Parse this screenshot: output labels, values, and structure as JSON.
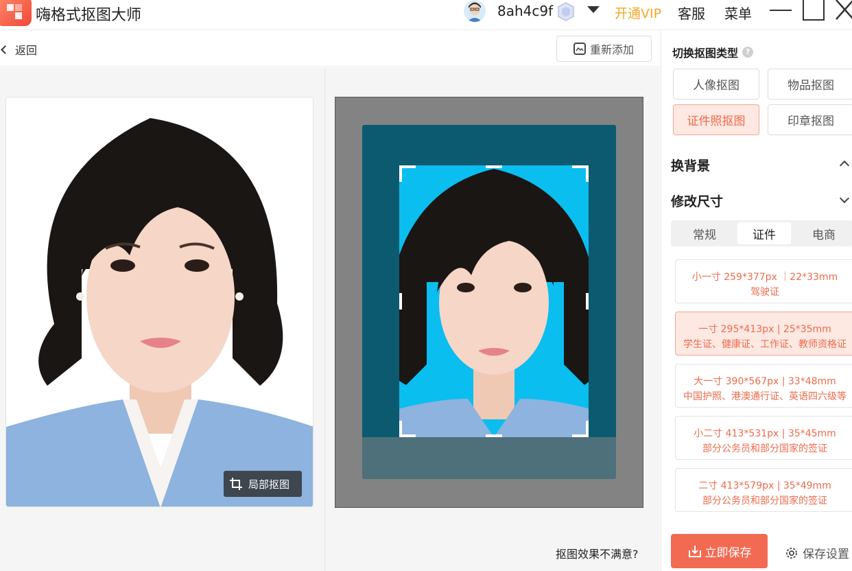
{
  "app": {
    "title": "嗨格式抠图大师"
  },
  "header": {
    "username": "8ah4c9f",
    "vip_label": "开通VIP",
    "service_label": "客服",
    "menu_label": "菜单"
  },
  "toolbar": {
    "back_label": "返回",
    "readd_label": "重新添加"
  },
  "original": {
    "crop_label": "局部抠图"
  },
  "result": {
    "unsatisfied_label": "抠图效果不满意?"
  },
  "sidebar": {
    "type_title": "切换抠图类型",
    "types": [
      {
        "label": "人像抠图",
        "active": false
      },
      {
        "label": "物品抠图",
        "active": false
      },
      {
        "label": "证件照抠图",
        "active": true
      },
      {
        "label": "印章抠图",
        "active": false
      }
    ],
    "bg_title": "换背景",
    "size_title": "修改尺寸",
    "size_tabs": [
      {
        "label": "常规",
        "active": false
      },
      {
        "label": "证件",
        "active": true
      },
      {
        "label": "电商",
        "active": false
      }
    ],
    "sizes": [
      {
        "line1": "小一寸 259*377px ｜22*33mm",
        "line2": "驾驶证",
        "active": false
      },
      {
        "line1": "一寸 295*413px | 25*35mm",
        "line2": "学生证、健康证、工作证、教师资格证",
        "active": true
      },
      {
        "line1": "大一寸 390*567px | 33*48mm",
        "line2": "中国护照、港澳通行证、英语四六级等",
        "active": false
      },
      {
        "line1": "小二寸 413*531px | 35*45mm",
        "line2": "部分公务员和部分国家的签证",
        "active": false
      },
      {
        "line1": "二寸 413*579px | 35*49mm",
        "line2": "部分公务员和部分国家的签证",
        "active": false
      }
    ],
    "save_label": "立即保存",
    "save_settings_label": "保存设置"
  },
  "colors": {
    "accent": "#f26a52",
    "vip": "#f5a623",
    "result_bg": "#0c5a6f",
    "photo_bg": "#0abef0"
  },
  "icons": [
    "app-logo-icon",
    "vip-badge-icon",
    "chevron-down-icon",
    "minimize-icon",
    "maximize-icon",
    "close-icon",
    "back-chevron-icon",
    "image-add-icon",
    "crop-icon",
    "help-icon",
    "chevron-up-icon",
    "download-icon",
    "gear-icon"
  ]
}
